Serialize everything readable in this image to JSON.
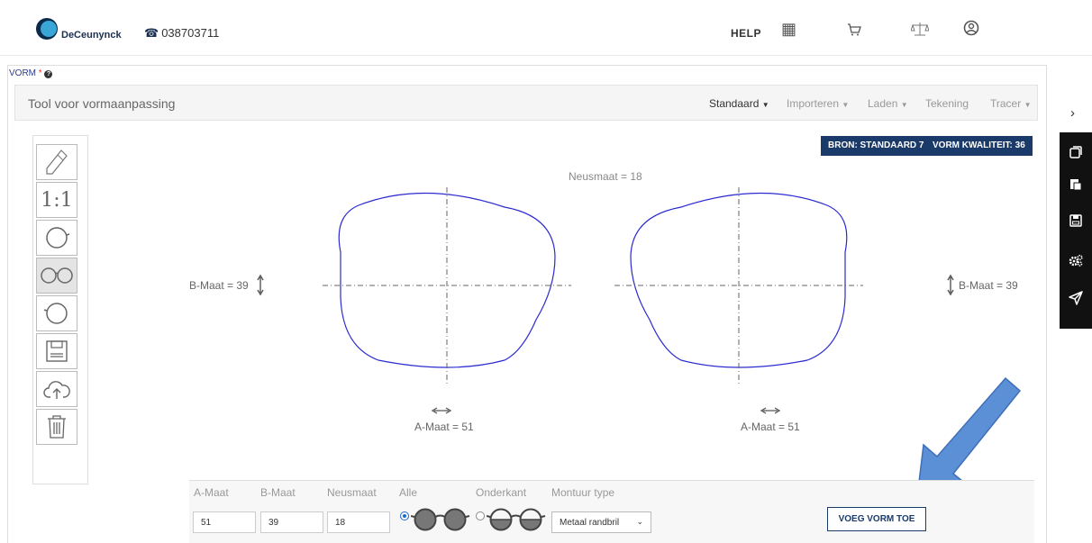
{
  "header": {
    "brand": "DeCeunynck",
    "phone": "038703711",
    "help": "HELP",
    "icons": [
      "grid-icon",
      "cart-icon",
      "scale-icon",
      "user-icon"
    ]
  },
  "section": {
    "label": "VORM",
    "required": "*"
  },
  "toolbar": {
    "title": "Tool voor vormaanpassing",
    "menus": [
      "Standaard",
      "Importeren",
      "Laden",
      "Tekening",
      "Tracer"
    ]
  },
  "tools": {
    "ratio": "1:1"
  },
  "badges": {
    "bron": "BRON: STANDAARD 7",
    "kwaliteit": "VORM KWALITEIT: 36"
  },
  "shape": {
    "neusmaat": "Neusmaat = 18",
    "b_left": "B-Maat = 39",
    "b_right": "B-Maat = 39",
    "a_left": "A-Maat = 51",
    "a_right": "A-Maat = 51",
    "lens_color": "#2b2bd0"
  },
  "form": {
    "labels": {
      "a": "A-Maat",
      "b": "B-Maat",
      "neus": "Neusmaat",
      "alle": "Alle",
      "onderkant": "Onderkant",
      "montuur": "Montuur type"
    },
    "values": {
      "a": "51",
      "b": "39",
      "neus": "18",
      "montuur": "Metaal randbril"
    },
    "button": "VOEG VORM TOE"
  },
  "colors": {
    "navy": "#1a3a6a",
    "arrow": "#5b8fd6"
  }
}
